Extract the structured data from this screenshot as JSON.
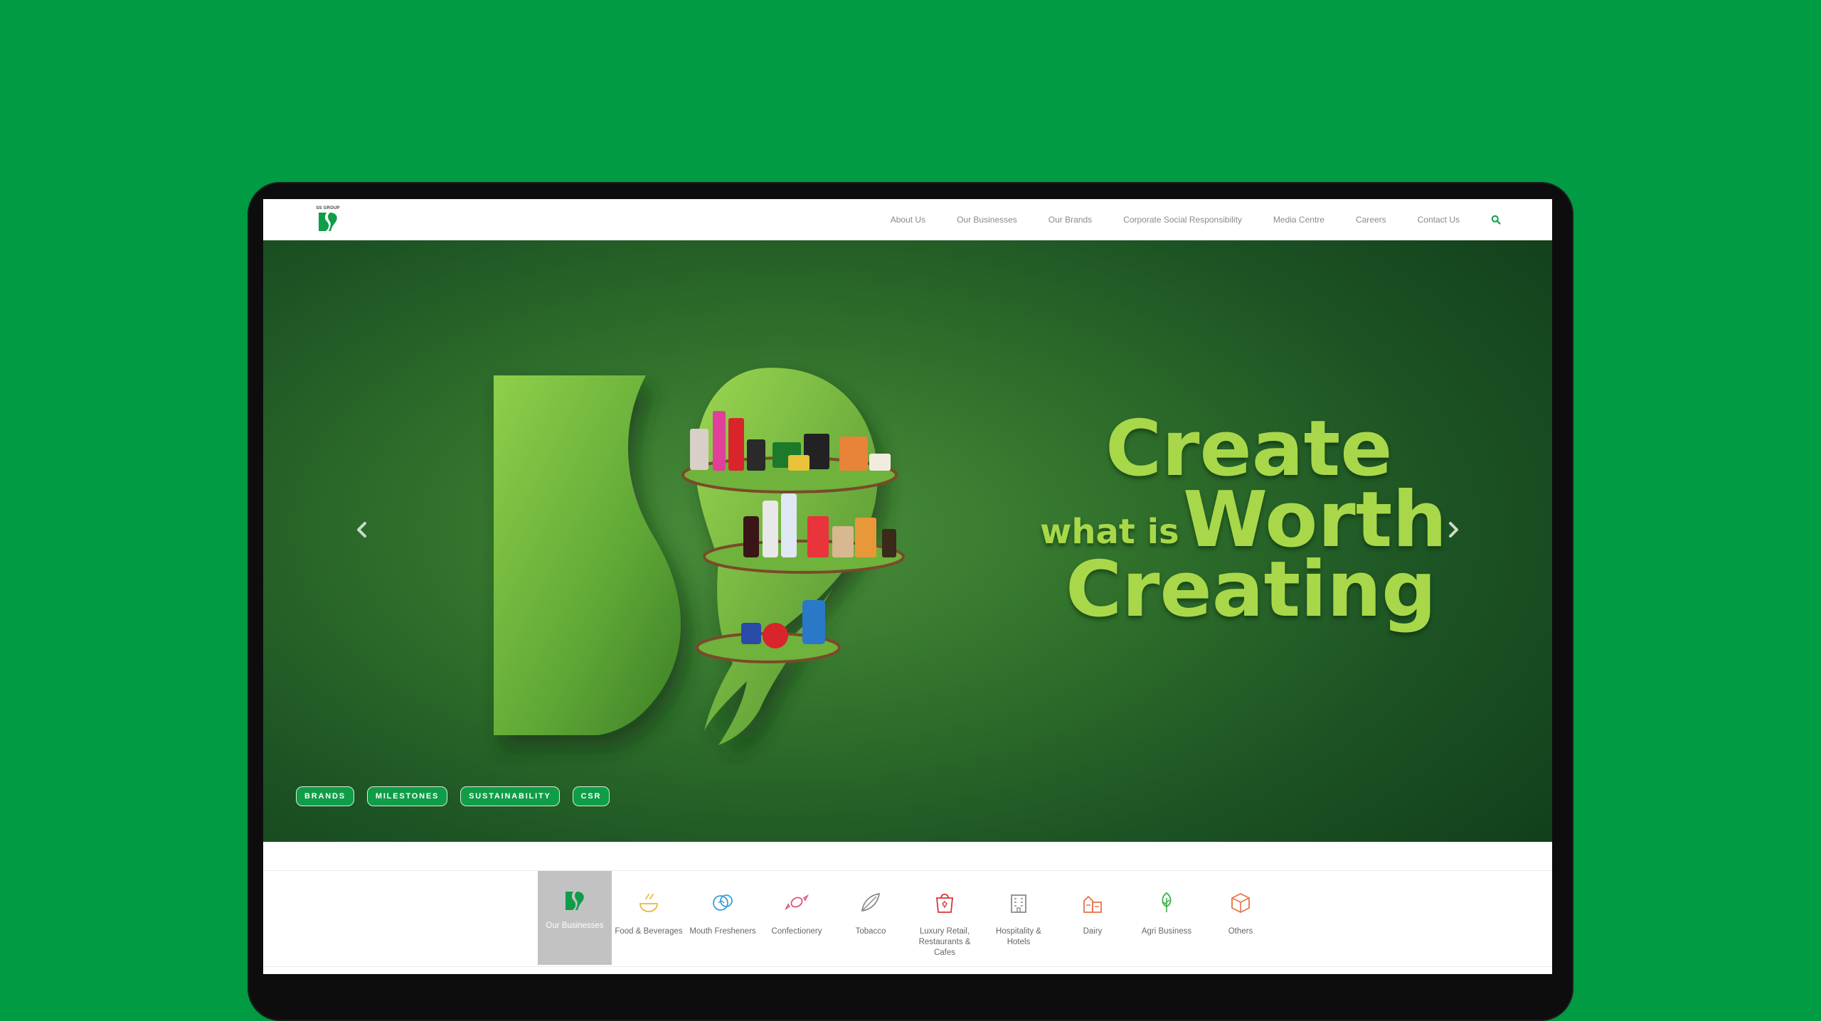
{
  "brand": {
    "logo_text": "SS GROUP",
    "primary_color": "#009b43",
    "accent_green": "#0f9d48"
  },
  "nav": {
    "items": [
      "About Us",
      "Our Businesses",
      "Our Brands",
      "Corporate Social Responsibility",
      "Media Centre",
      "Careers",
      "Contact Us"
    ],
    "search_icon": "search-icon"
  },
  "hero": {
    "line1": "Create",
    "line2a": "what is",
    "line2b": "Worth",
    "line3": "Creating",
    "prev_icon": "chevron-left-icon",
    "next_icon": "chevron-right-icon",
    "pills": [
      "BRANDS",
      "MILESTONES",
      "SUSTAINABILITY",
      "CSR"
    ]
  },
  "businesses": {
    "items": [
      {
        "label": "Our Businesses",
        "icon": "ss-logo-icon",
        "active": true
      },
      {
        "label": "Food & Beverages",
        "icon": "food-bowl-icon",
        "color": "#e8b838"
      },
      {
        "label": "Mouth Fresheners",
        "icon": "mouth-freshener-icon",
        "color": "#3aa0d8"
      },
      {
        "label": "Confectionery",
        "icon": "candy-icon",
        "color": "#e0557a"
      },
      {
        "label": "Tobacco",
        "icon": "tobacco-leaf-icon",
        "color": "#8a8a8a"
      },
      {
        "label": "Luxury Retail, Restaurants & Cafes",
        "icon": "shopping-bag-icon",
        "color": "#d8353a"
      },
      {
        "label": "Hospitality & Hotels",
        "icon": "hotel-building-icon",
        "color": "#8a8a8a"
      },
      {
        "label": "Dairy",
        "icon": "dairy-icon",
        "color": "#e8734a"
      },
      {
        "label": "Agri Business",
        "icon": "tree-icon",
        "color": "#3fae49"
      },
      {
        "label": "Others",
        "icon": "box-icon",
        "color": "#e8734a"
      }
    ]
  }
}
